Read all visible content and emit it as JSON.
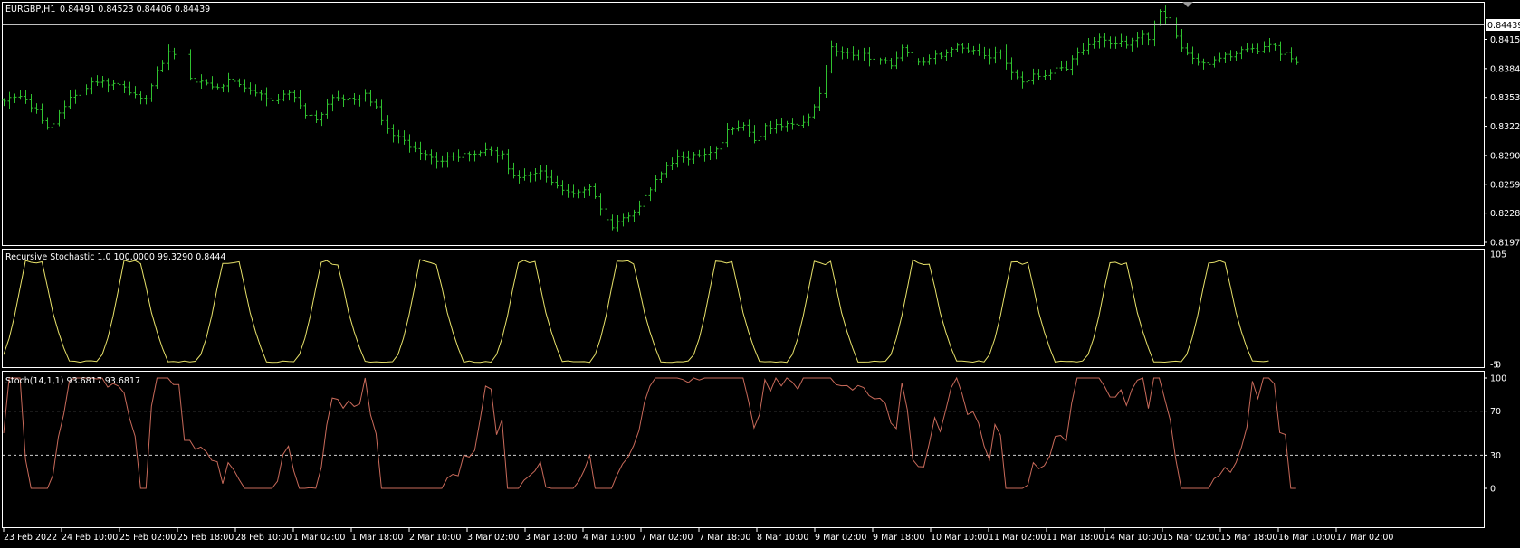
{
  "header": {
    "symbol": "EURGBP,H1",
    "ohlc": "0.84491 0.84523 0.84406 0.84439"
  },
  "colors": {
    "background": "#000000",
    "frame": "#ffffff",
    "candles": "#2fc12f",
    "recursive_line": "#e8e26a",
    "stoch_line": "#c96a5a",
    "bid_line": "#c0c0c0"
  },
  "chart_data": [
    {
      "type": "bar",
      "subtype": "ohlc",
      "title": "EURGBP,H1",
      "last_price_label": "0.84439",
      "yticks": [
        "0.84155",
        "0.83840",
        "0.83530",
        "0.83220",
        "0.82905",
        "0.82595",
        "0.82285",
        "0.81970"
      ],
      "ylim": [
        0.8197,
        0.8452
      ],
      "xticks": [
        "23 Feb 2022",
        "24 Feb 10:00",
        "25 Feb 02:00",
        "25 Feb 18:00",
        "28 Feb 10:00",
        "1 Mar 02:00",
        "1 Mar 18:00",
        "2 Mar 10:00",
        "3 Mar 02:00",
        "3 Mar 18:00",
        "4 Mar 10:00",
        "7 Mar 02:00",
        "7 Mar 18:00",
        "8 Mar 10:00",
        "9 Mar 02:00",
        "9 Mar 18:00",
        "10 Mar 10:00",
        "11 Mar 02:00",
        "11 Mar 18:00",
        "14 Mar 10:00",
        "15 Mar 02:00",
        "15 Mar 18:00",
        "16 Mar 10:00",
        "17 Mar 02:00"
      ],
      "close_trend": [
        [
          0,
          0.835
        ],
        [
          3,
          0.8352
        ],
        [
          6,
          0.834
        ],
        [
          8,
          0.8318
        ],
        [
          11,
          0.8345
        ],
        [
          14,
          0.8362
        ],
        [
          17,
          0.837
        ],
        [
          20,
          0.8368
        ],
        [
          23,
          0.8358
        ],
        [
          26,
          0.8352
        ],
        [
          28,
          0.838
        ],
        [
          30,
          0.84
        ],
        [
          31,
          0.8402
        ],
        [
          33,
          0.8375
        ],
        [
          36,
          0.8368
        ],
        [
          39,
          0.8362
        ],
        [
          41,
          0.8372
        ],
        [
          44,
          0.8365
        ],
        [
          47,
          0.8355
        ],
        [
          50,
          0.835
        ],
        [
          52,
          0.8358
        ],
        [
          55,
          0.8335
        ],
        [
          57,
          0.8328
        ],
        [
          60,
          0.8352
        ],
        [
          63,
          0.835
        ],
        [
          66,
          0.8355
        ],
        [
          68,
          0.8342
        ],
        [
          70,
          0.832
        ],
        [
          73,
          0.8305
        ],
        [
          76,
          0.8295
        ],
        [
          79,
          0.8285
        ],
        [
          82,
          0.829
        ],
        [
          85,
          0.8292
        ],
        [
          88,
          0.8295
        ],
        [
          91,
          0.829
        ],
        [
          93,
          0.8268
        ],
        [
          96,
          0.8272
        ],
        [
          98,
          0.8275
        ],
        [
          100,
          0.826
        ],
        [
          102,
          0.8252
        ],
        [
          104,
          0.825
        ],
        [
          107,
          0.8255
        ],
        [
          109,
          0.8232
        ],
        [
          111,
          0.821
        ],
        [
          113,
          0.8225
        ],
        [
          116,
          0.8235
        ],
        [
          118,
          0.8255
        ],
        [
          121,
          0.828
        ],
        [
          124,
          0.829
        ],
        [
          127,
          0.8288
        ],
        [
          130,
          0.8295
        ],
        [
          132,
          0.8318
        ],
        [
          135,
          0.8322
        ],
        [
          137,
          0.8305
        ],
        [
          139,
          0.832
        ],
        [
          142,
          0.8322
        ],
        [
          145,
          0.8325
        ],
        [
          147,
          0.833
        ],
        [
          149,
          0.8355
        ],
        [
          151,
          0.8405
        ],
        [
          154,
          0.8402
        ],
        [
          157,
          0.8398
        ],
        [
          160,
          0.8392
        ],
        [
          162,
          0.8388
        ],
        [
          164,
          0.8405
        ],
        [
          166,
          0.8392
        ],
        [
          168,
          0.839
        ],
        [
          171,
          0.84
        ],
        [
          174,
          0.8408
        ],
        [
          177,
          0.8405
        ],
        [
          180,
          0.8398
        ],
        [
          182,
          0.84
        ],
        [
          184,
          0.8378
        ],
        [
          186,
          0.837
        ],
        [
          189,
          0.8378
        ],
        [
          192,
          0.8382
        ],
        [
          194,
          0.8385
        ],
        [
          196,
          0.84
        ],
        [
          198,
          0.8412
        ],
        [
          200,
          0.8418
        ],
        [
          202,
          0.841
        ],
        [
          205,
          0.8412
        ],
        [
          207,
          0.842
        ],
        [
          209,
          0.8418
        ],
        [
          211,
          0.8445
        ],
        [
          213,
          0.843
        ],
        [
          215,
          0.8405
        ],
        [
          217,
          0.8395
        ],
        [
          220,
          0.839
        ],
        [
          223,
          0.8398
        ],
        [
          226,
          0.8402
        ],
        [
          229,
          0.8405
        ],
        [
          231,
          0.841
        ],
        [
          233,
          0.8402
        ],
        [
          235,
          0.8395
        ],
        [
          238,
          0.8388
        ],
        [
          241,
          0.8395
        ],
        [
          244,
          0.8385
        ],
        [
          247,
          0.8378
        ],
        [
          249,
          0.838
        ],
        [
          251,
          0.843
        ],
        [
          252,
          0.8445
        ]
      ]
    },
    {
      "type": "line",
      "title": "Recursive Stochastic 1.0 100.0000 99.3290 0.8444",
      "ylim": [
        -2,
        105
      ],
      "yticks": [
        "105",
        "-5",
        "0"
      ],
      "period_bars": 18
    },
    {
      "type": "line",
      "title": "Stoch(14,1,1) 93.6817 93.6817",
      "ylim": [
        0,
        100
      ],
      "yticks": [
        "100",
        "70",
        "30",
        "0"
      ],
      "levels": [
        70,
        30
      ]
    }
  ]
}
